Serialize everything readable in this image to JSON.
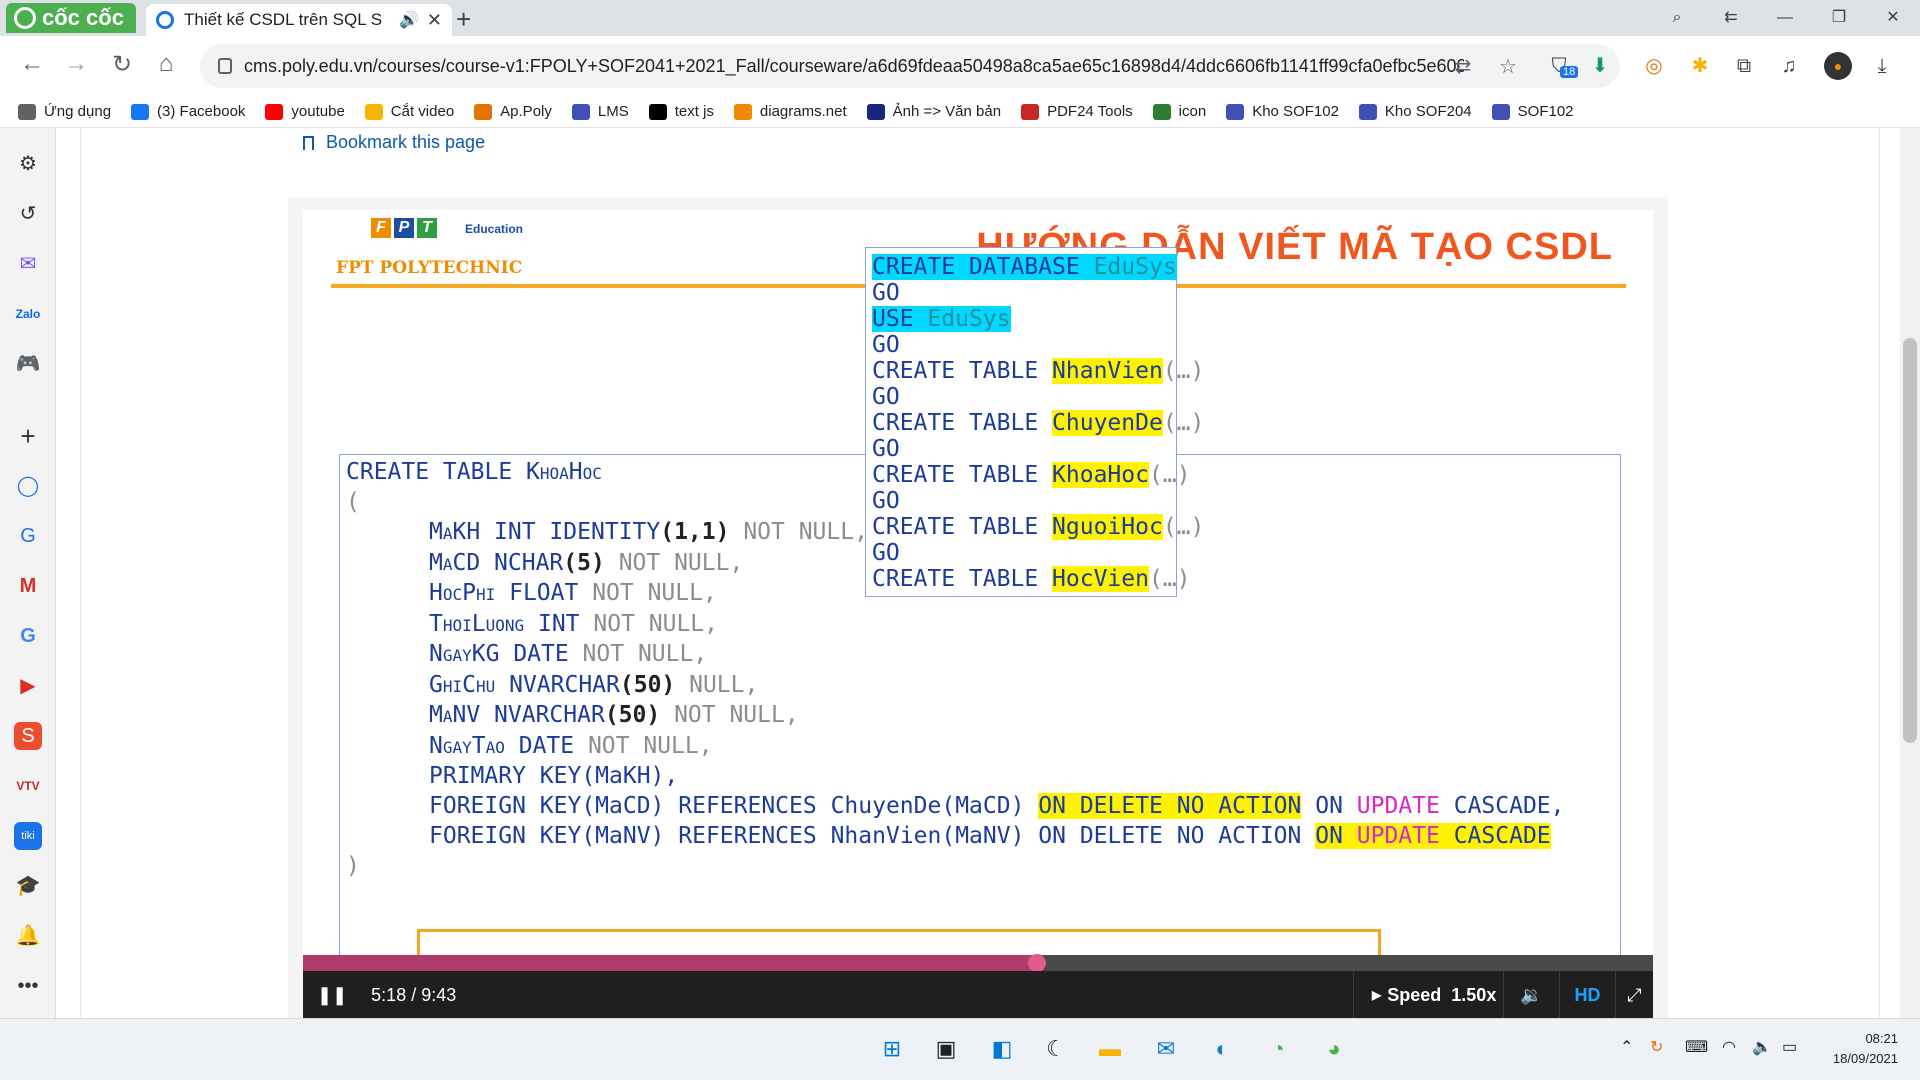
{
  "browser": {
    "brand": "cốc cốc",
    "tab_title": "Thiết kế CSDL trên SQL S",
    "url": "cms.poly.edu.vn/courses/course-v1:FPOLY+SOF2041+2021_Fall/courseware/a6d69fdeaa50498a8ca5ae65c16898d4/4ddc6606fb1141ff99cfa0efbc5e6002/...",
    "ext_badge": "18"
  },
  "bookmarks": [
    {
      "label": "Ứng dụng",
      "color": "#5f6368"
    },
    {
      "label": "(3) Facebook",
      "color": "#1877f2"
    },
    {
      "label": "youtube",
      "color": "#ff0000"
    },
    {
      "label": "Cắt video",
      "color": "#f4b400"
    },
    {
      "label": "Ap.Poly",
      "color": "#e37400"
    },
    {
      "label": "LMS",
      "color": "#3f51b5"
    },
    {
      "label": "text js",
      "color": "#000000"
    },
    {
      "label": "diagrams.net",
      "color": "#f08705"
    },
    {
      "label": "Ảnh => Văn bản",
      "color": "#1a237e"
    },
    {
      "label": "PDF24 Tools",
      "color": "#c62828"
    },
    {
      "label": "icon",
      "color": "#2e7d32"
    },
    {
      "label": "Kho SOF102",
      "color": "#3f51b5"
    },
    {
      "label": "Kho SOF204",
      "color": "#3f51b5"
    },
    {
      "label": "SOF102",
      "color": "#3f51b5"
    }
  ],
  "page": {
    "bookmark_link": "Bookmark this page"
  },
  "slide": {
    "logo_letters": [
      "F",
      "P",
      "T"
    ],
    "logo_edu": "Education",
    "org": "FPT POLYTECHNIC",
    "title": "HƯỚNG DẪN VIẾT MÃ TẠO CSDL",
    "create_table": {
      "header_kw": "CREATE TABLE",
      "header_name": "KhoaHoc",
      "open_paren": "(",
      "cols": [
        {
          "name": "MaKH",
          "type": "INT IDENTITY",
          "args": "(1,1)",
          "rest": " NOT NULL,"
        },
        {
          "name": "MaCD",
          "type": "NCHAR",
          "args": "(5)",
          "rest": " NOT NULL,"
        },
        {
          "name": "HocPhi",
          "type": "FLOAT",
          "args": "",
          "rest": " NOT NULL,"
        },
        {
          "name": "ThoiLuong",
          "type": "INT",
          "args": "",
          "rest": " NOT NULL,"
        },
        {
          "name": "NgayKG",
          "type": "DATE",
          "args": "",
          "rest": " NOT NULL,"
        },
        {
          "name": "GhiChu",
          "type": "NVARCHAR",
          "args": "(50)",
          "rest": " NULL,"
        },
        {
          "name": "MaNV",
          "type": "NVARCHAR",
          "args": "(50)",
          "rest": " NOT NULL,"
        },
        {
          "name": "NgayTao",
          "type": "DATE",
          "args": "",
          "rest": " NOT NULL,"
        }
      ],
      "pk": "PRIMARY KEY(MaKH),",
      "fk1": {
        "lead": "FOREIGN KEY(MaCD) REFERENCES ChuyenDe(MaCD) ",
        "hl": "ON DELETE NO ACTION",
        "tail_on": " ON ",
        "tail_upd": "UPDATE",
        "tail_cas": " CASCADE,"
      },
      "fk2": {
        "lead": "FOREIGN KEY(MaNV) REFERENCES NhanVien(MaNV) ON DELETE NO ACTION ",
        "hl_on": "ON ",
        "hl_upd": "UPDATE",
        "hl_cas": " CASCADE"
      },
      "close": ")"
    },
    "db_script": {
      "create_db": "CREATE DATABASE",
      "db_name": "EduSys",
      "go": "GO",
      "use": "USE",
      "create_table": "CREATE TABLE",
      "tables": [
        "NhanVien",
        "ChuyenDe",
        "KhoaHoc",
        "NguoiHoc",
        "HocVien"
      ],
      "suffix": "(…)"
    }
  },
  "player": {
    "time": "5:18 / 9:43",
    "progress": 0.5436,
    "speed_label": "Speed",
    "speed_value": "1.50x",
    "hd": "HD"
  },
  "taskbar": {
    "time": "08:21",
    "date": "18/09/2021"
  }
}
